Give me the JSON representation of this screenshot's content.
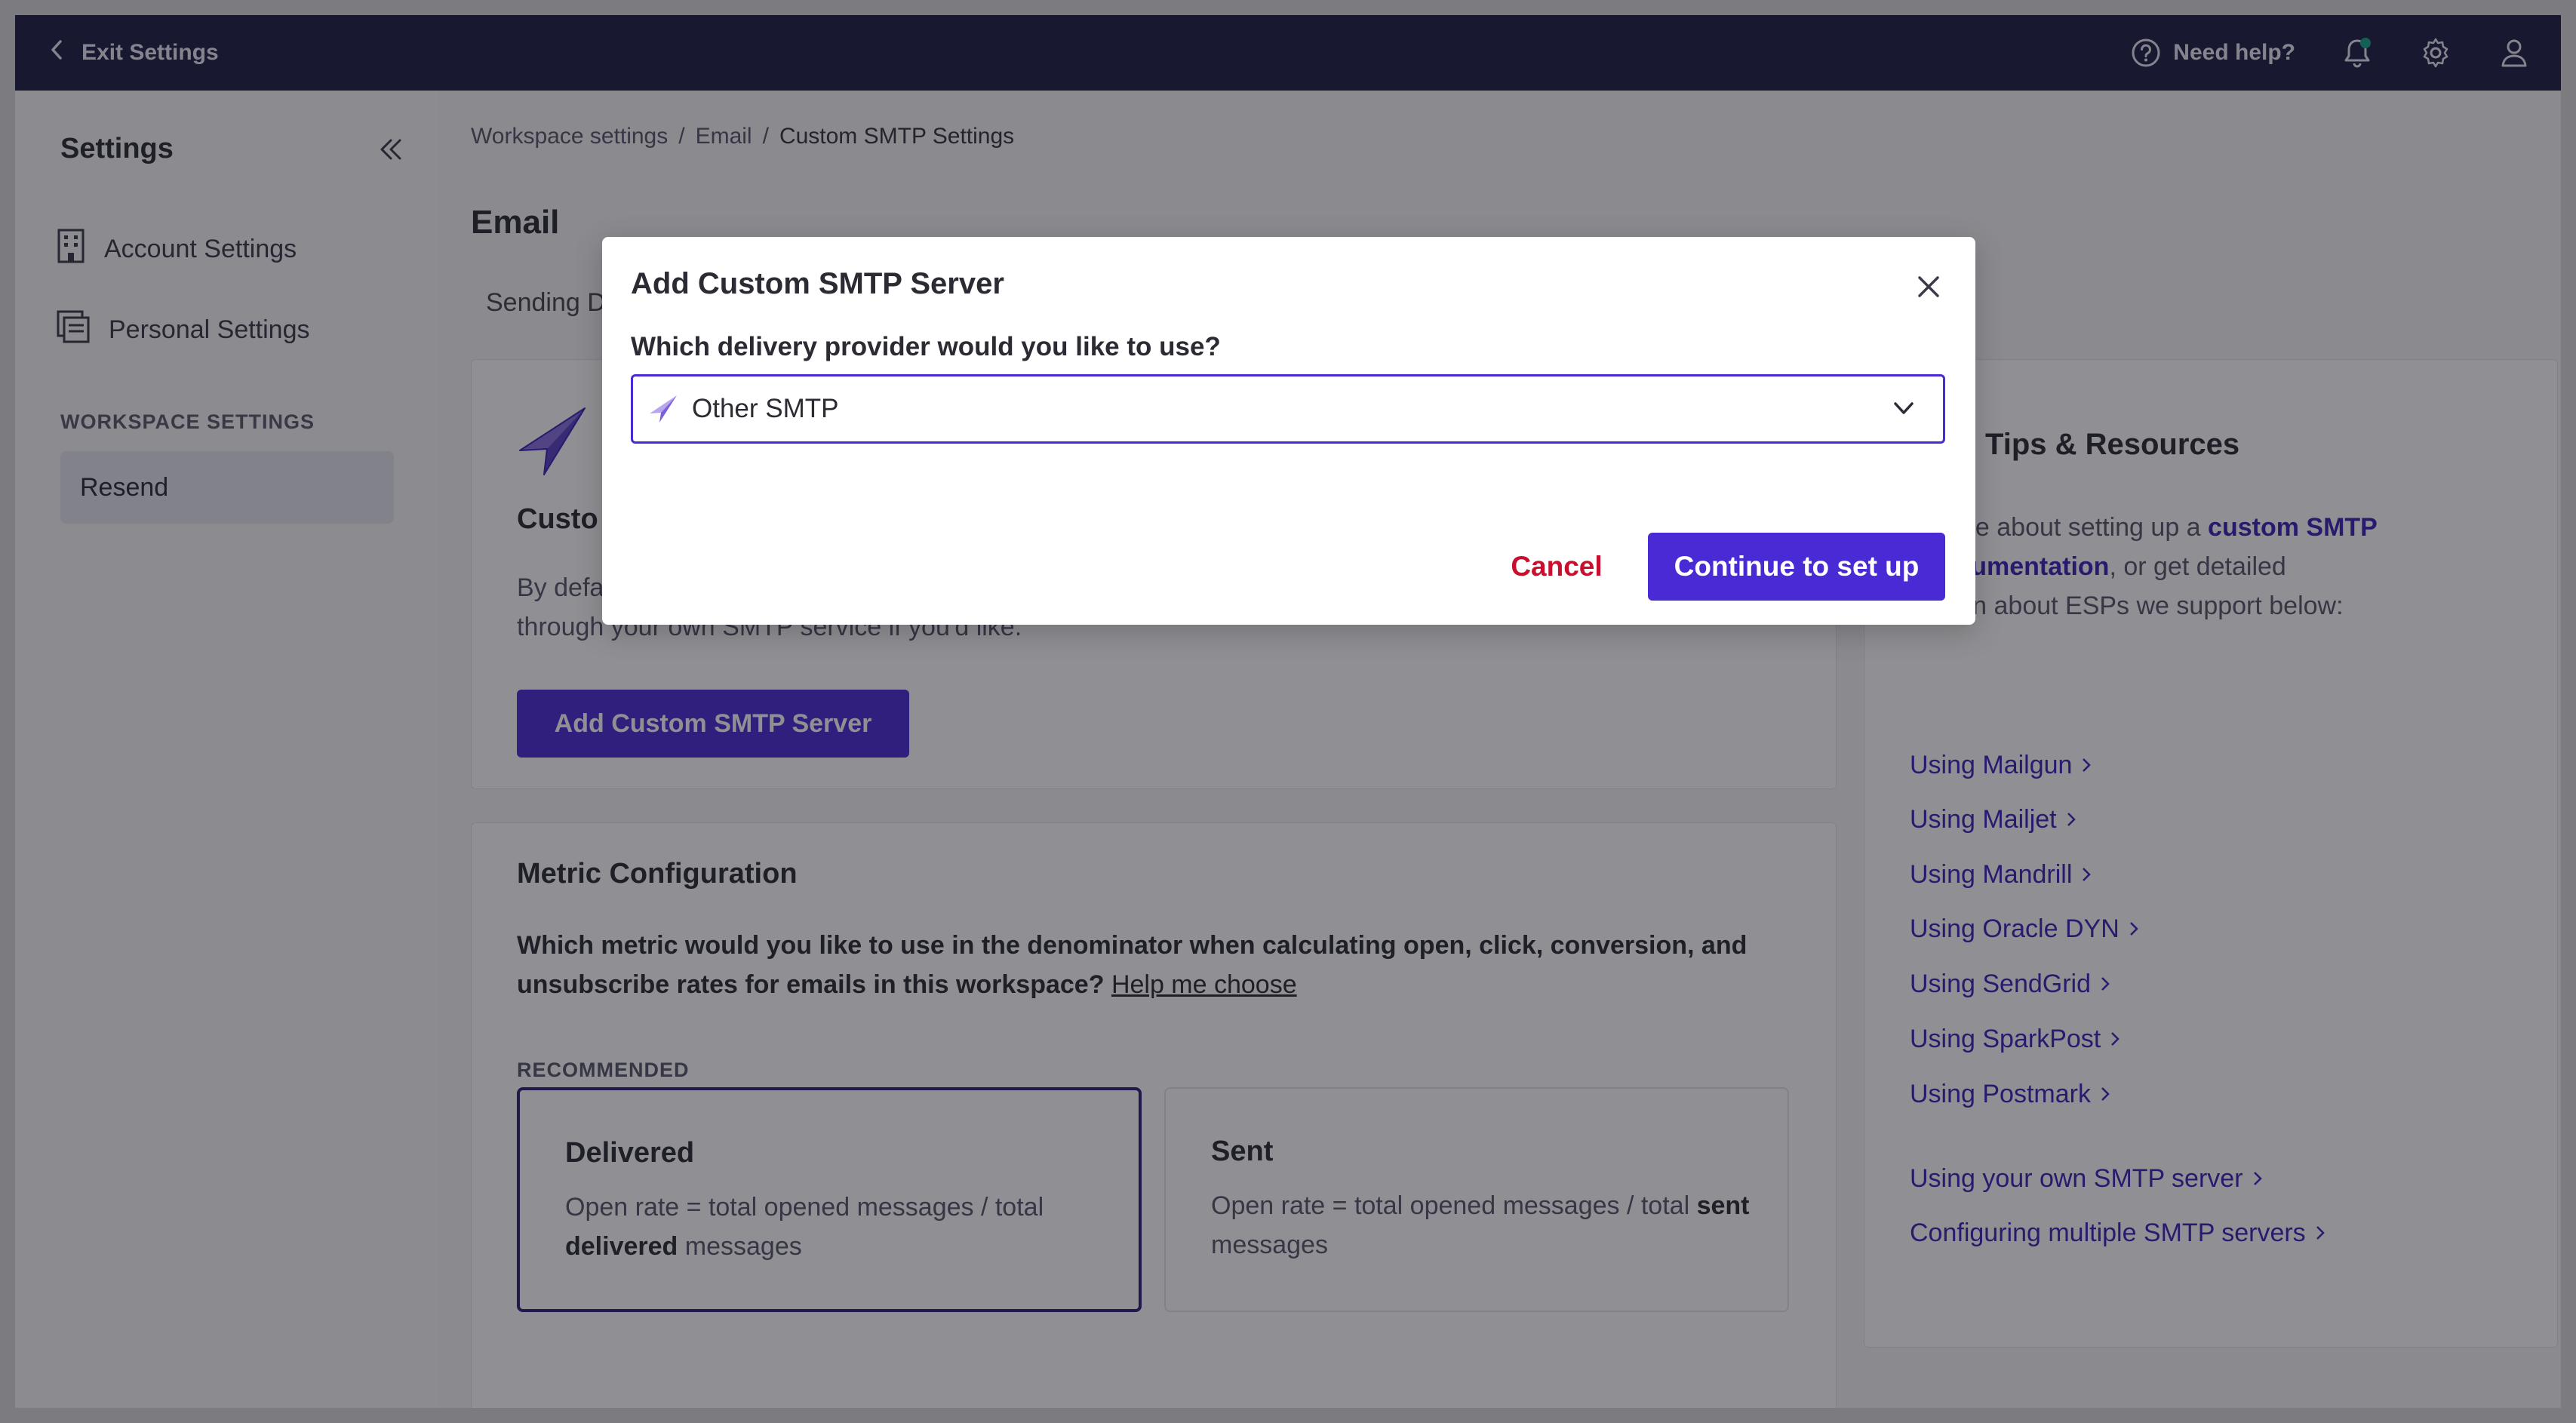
{
  "topbar": {
    "exit_label": "Exit Settings",
    "help_label": "Need help?",
    "icons": [
      "chevron-left-icon",
      "question-circle-icon",
      "bell-icon",
      "gear-icon",
      "user-icon"
    ]
  },
  "sidebar": {
    "title": "Settings",
    "items": [
      {
        "label": "Account Settings",
        "icon": "building-icon"
      },
      {
        "label": "Personal Settings",
        "icon": "person-card-icon"
      }
    ],
    "section_label": "WORKSPACE SETTINGS",
    "active_item": "Resend"
  },
  "main": {
    "breadcrumbs": [
      "Workspace settings",
      "/",
      "Email",
      "/",
      "Custom SMTP Settings"
    ],
    "title": "Email",
    "tab_label": "Sending D",
    "custom_card": {
      "title": "Custo",
      "text_line1": "By defa",
      "text_line2": "through your own SMTP service if you'd like.",
      "button_label": "Add Custom SMTP Server"
    },
    "metric": {
      "title": "Metric Configuration",
      "question": "Which metric would you like to use in the denominator when calculating open, click, conversion, and unsubscribe rates for emails in this workspace?",
      "help_link": "Help me choose",
      "recommended": "RECOMMENDED",
      "options": [
        {
          "name": "Delivered",
          "desc_prefix": "Open rate = total opened messages / total",
          "desc_bold": "delivered",
          "desc_suffix": "messages",
          "selected": true
        },
        {
          "name": "Sent",
          "desc_prefix": "Open rate = total opened messages / total",
          "desc_bold": "sent",
          "desc_suffix": "messages",
          "selected": false
        }
      ]
    },
    "tips": {
      "title": "Tips & Resources",
      "text_a": "n more about setting up a ",
      "text_link1": "custom SMTP",
      "text_b": "r ",
      "text_link2": "documentation",
      "text_c": ", or get detailed",
      "text_d": "mation about ESPs we support below:",
      "links": [
        "Using Mailgun",
        "Using Mailjet",
        "Using Mandrill",
        "Using Oracle DYN",
        "Using SendGrid",
        "Using SparkPost",
        "Using Postmark",
        "Using your own SMTP server",
        "Configuring multiple SMTP servers"
      ]
    }
  },
  "modal": {
    "title": "Add Custom SMTP Server",
    "question": "Which delivery provider would you like to use?",
    "selected_provider": "Other SMTP",
    "cancel_label": "Cancel",
    "continue_label": "Continue to set up"
  },
  "colors": {
    "topbar": "#1e1d45",
    "primary": "#4a2ad4",
    "link": "#3b22b8",
    "danger": "#c8102e"
  }
}
